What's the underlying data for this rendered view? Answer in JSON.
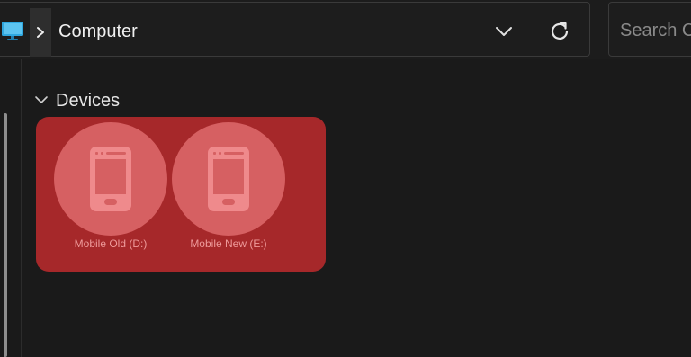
{
  "address_bar": {
    "location_icon": "computer-monitor-icon",
    "breadcrumb_separator_icon": "chevron-right-icon",
    "current_location": "Computer",
    "history_dropdown_icon": "chevron-down-icon",
    "refresh_icon": "refresh-icon"
  },
  "search": {
    "placeholder": "Search C"
  },
  "content": {
    "group": {
      "collapse_icon": "chevron-down-icon",
      "label": "Devices"
    },
    "devices": [
      {
        "label": "Mobile Old (D:)",
        "icon": "smartphone-icon"
      },
      {
        "label": "Mobile New (E:)",
        "icon": "smartphone-icon"
      }
    ]
  },
  "colors": {
    "highlight": "#a6282a",
    "device_circle": "#d66062",
    "device_glyph": "#ef8a8c",
    "monitor_icon": "#2fa8e0"
  }
}
